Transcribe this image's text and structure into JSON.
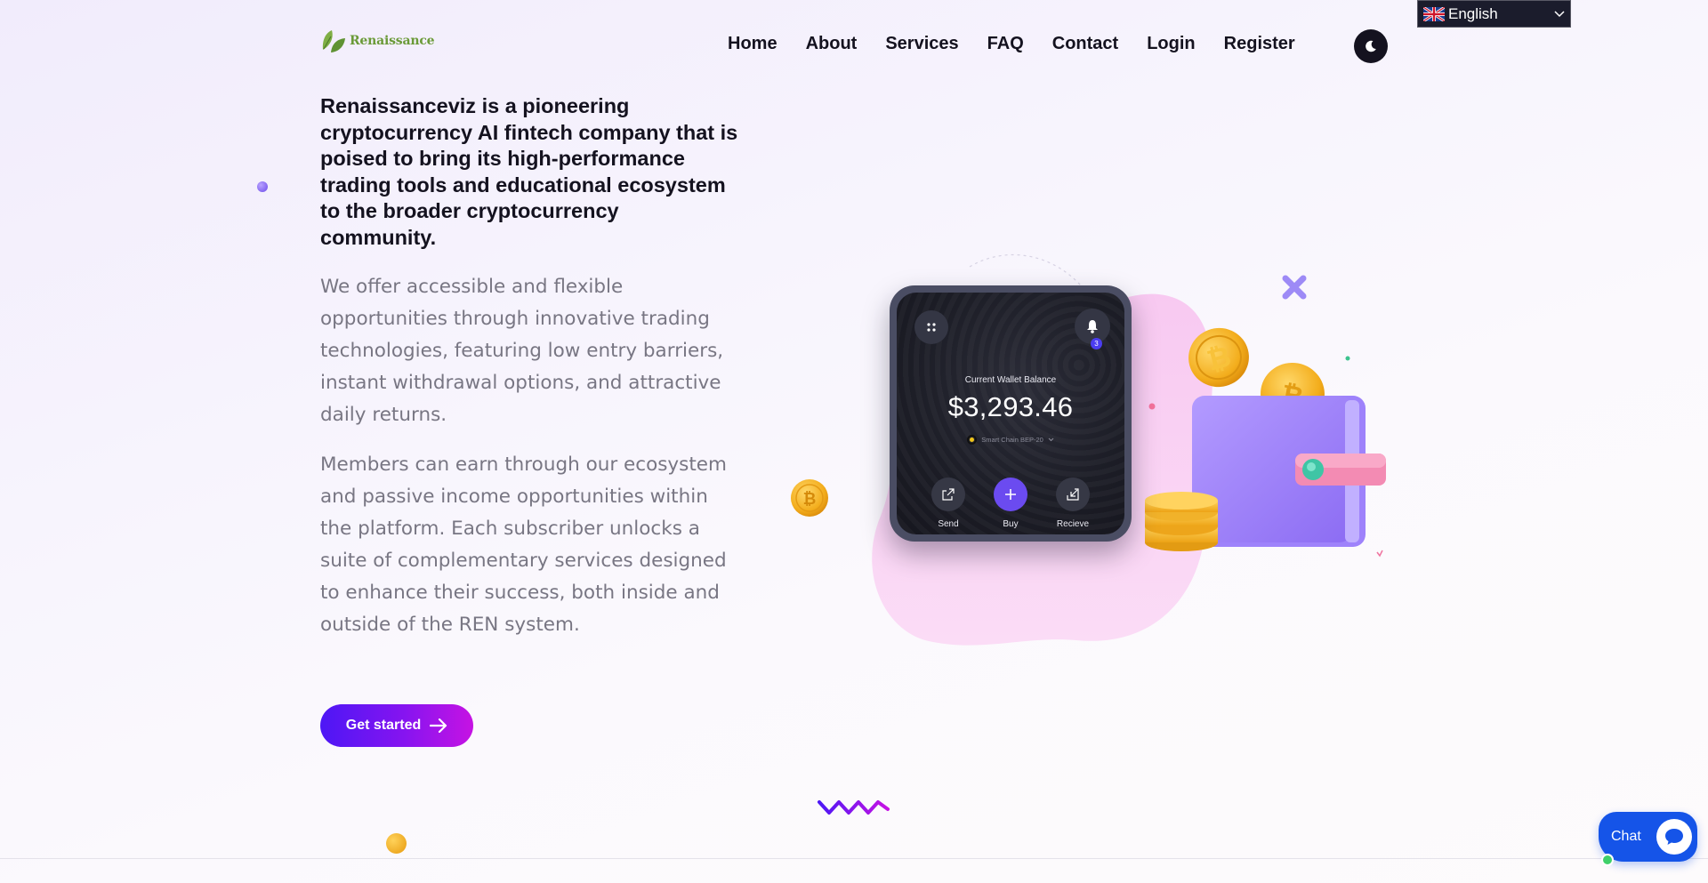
{
  "brand": {
    "name": "Renaissance",
    "color": "#6a9a37"
  },
  "nav": {
    "items": [
      {
        "label": "Home"
      },
      {
        "label": "About"
      },
      {
        "label": "Services"
      },
      {
        "label": "FAQ"
      },
      {
        "label": "Contact"
      },
      {
        "label": "Login"
      },
      {
        "label": "Register"
      }
    ],
    "theme_toggle_icon": "moon-icon"
  },
  "language": {
    "selected": "English",
    "flag_icon": "uk-flag-icon"
  },
  "hero": {
    "headline": "Renaissanceviz is a pioneering cryptocurrency AI fintech company that is poised to bring its high-performance trading tools and educational ecosystem to the broader cryptocurrency community.",
    "paragraph_1": "We offer accessible and flexible opportunities through innovative trading technologies, featuring low entry barriers, instant withdrawal options, and attractive daily returns.",
    "paragraph_2": "Members can earn through our ecosystem and passive income opportunities within the platform. Each subscriber unlocks a suite of complementary services designed to enhance their success, both inside and outside of the REN system.",
    "cta_label": "Get started",
    "cta_icon": "arrow-right-icon"
  },
  "wallet_card": {
    "notification_count": "3",
    "balance_label": "Current Wallet Balance",
    "balance": "$3,293.46",
    "chain": "Smart Chain BEP-20",
    "actions": [
      {
        "label": "Send",
        "icon": "send-arrow-icon"
      },
      {
        "label": "Buy",
        "icon": "plus-icon"
      },
      {
        "label": "Recieve",
        "icon": "receive-arrow-icon"
      }
    ]
  },
  "chat_widget": {
    "label": "Chat",
    "icon": "chat-bubble-icon"
  },
  "colors": {
    "accent_start": "#4d17f5",
    "accent_end": "#c613e3",
    "text_dark": "#14121f",
    "text_muted": "#787683",
    "chat_blue": "#1554e8",
    "online_green": "#3fd06a"
  }
}
